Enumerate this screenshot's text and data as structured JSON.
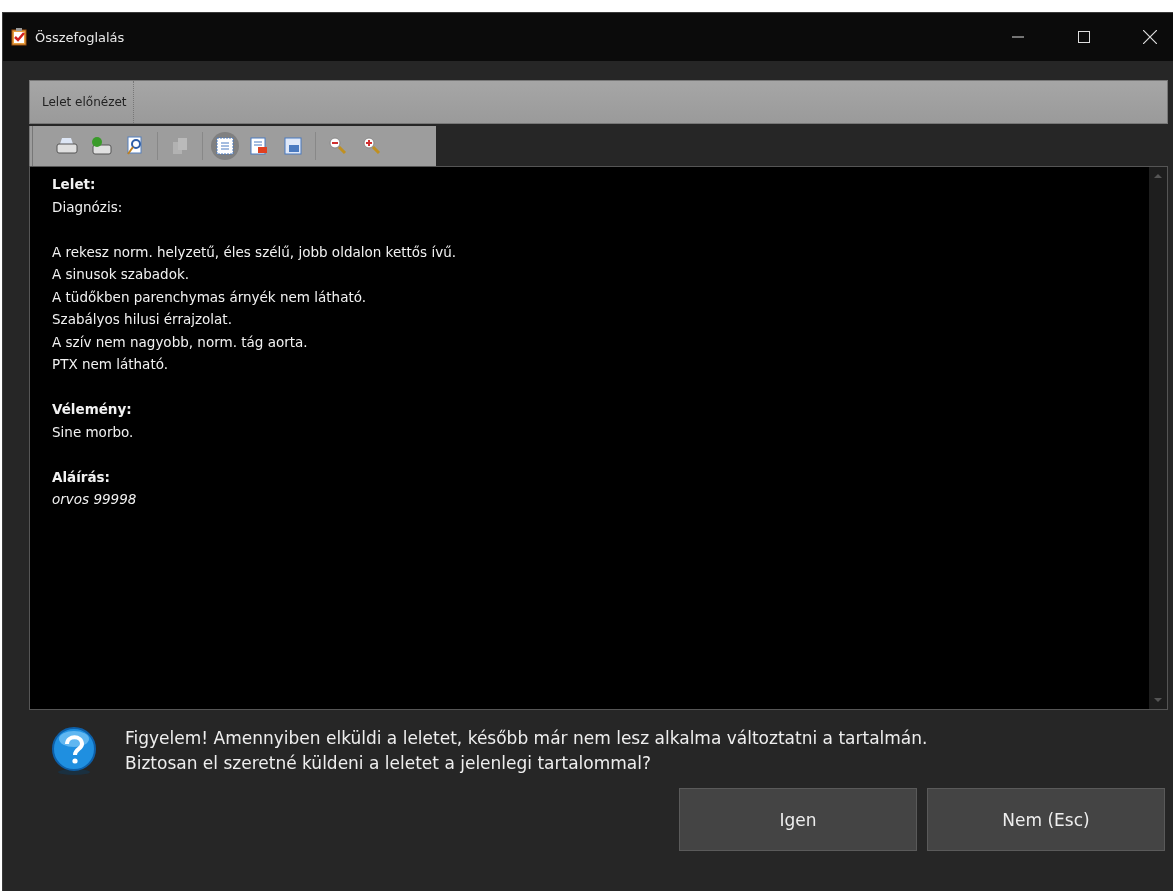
{
  "window": {
    "title": "Összefoglalás"
  },
  "tabs": [
    {
      "label": "Lelet előnézet",
      "selected": true
    }
  ],
  "toolbar": {
    "groups": [
      [
        {
          "kind": "print",
          "disabled": false,
          "selected": false
        },
        {
          "kind": "printsetup",
          "disabled": false,
          "selected": false
        },
        {
          "kind": "preview",
          "disabled": false,
          "selected": false
        }
      ],
      [
        {
          "kind": "copy",
          "disabled": true,
          "selected": false
        }
      ],
      [
        {
          "kind": "fit",
          "disabled": false,
          "selected": true
        },
        {
          "kind": "export",
          "disabled": false,
          "selected": false
        },
        {
          "kind": "save",
          "disabled": false,
          "selected": false
        }
      ],
      [
        {
          "kind": "zoomout",
          "disabled": false,
          "selected": false
        },
        {
          "kind": "zoomin",
          "disabled": false,
          "selected": false
        }
      ]
    ]
  },
  "document": {
    "lines": [
      {
        "kind": "heading",
        "text": "Lelet:"
      },
      {
        "kind": "text",
        "text": "Diagnózis:"
      },
      {
        "kind": "gap"
      },
      {
        "kind": "text",
        "text": "A rekesz norm. helyzetű, éles szélű, jobb oldalon kettős ívű."
      },
      {
        "kind": "text",
        "text": "A sinusok szabadok."
      },
      {
        "kind": "text",
        "text": "A tüdőkben parenchymas árnyék nem látható."
      },
      {
        "kind": "text",
        "text": "Szabályos hilusi érrajzolat."
      },
      {
        "kind": "text",
        "text": "A szív nem nagyobb, norm. tág aorta."
      },
      {
        "kind": "text",
        "text": "PTX nem látható."
      },
      {
        "kind": "gap"
      },
      {
        "kind": "heading",
        "text": "Vélemény:"
      },
      {
        "kind": "text",
        "text": "Sine morbo."
      },
      {
        "kind": "gap"
      },
      {
        "kind": "heading",
        "text": "Aláírás:"
      },
      {
        "kind": "italic",
        "text": "orvos 99998"
      }
    ]
  },
  "message": {
    "lines": [
      "Figyelem! Amennyiben elküldi a leletet, később már nem lesz alkalma változtatni a tartalmán.",
      "Biztosan el szeretné küldeni a leletet a jelenlegi tartalommal?"
    ]
  },
  "buttons": [
    {
      "label": "Igen"
    },
    {
      "label": "Nem (Esc)"
    }
  ]
}
